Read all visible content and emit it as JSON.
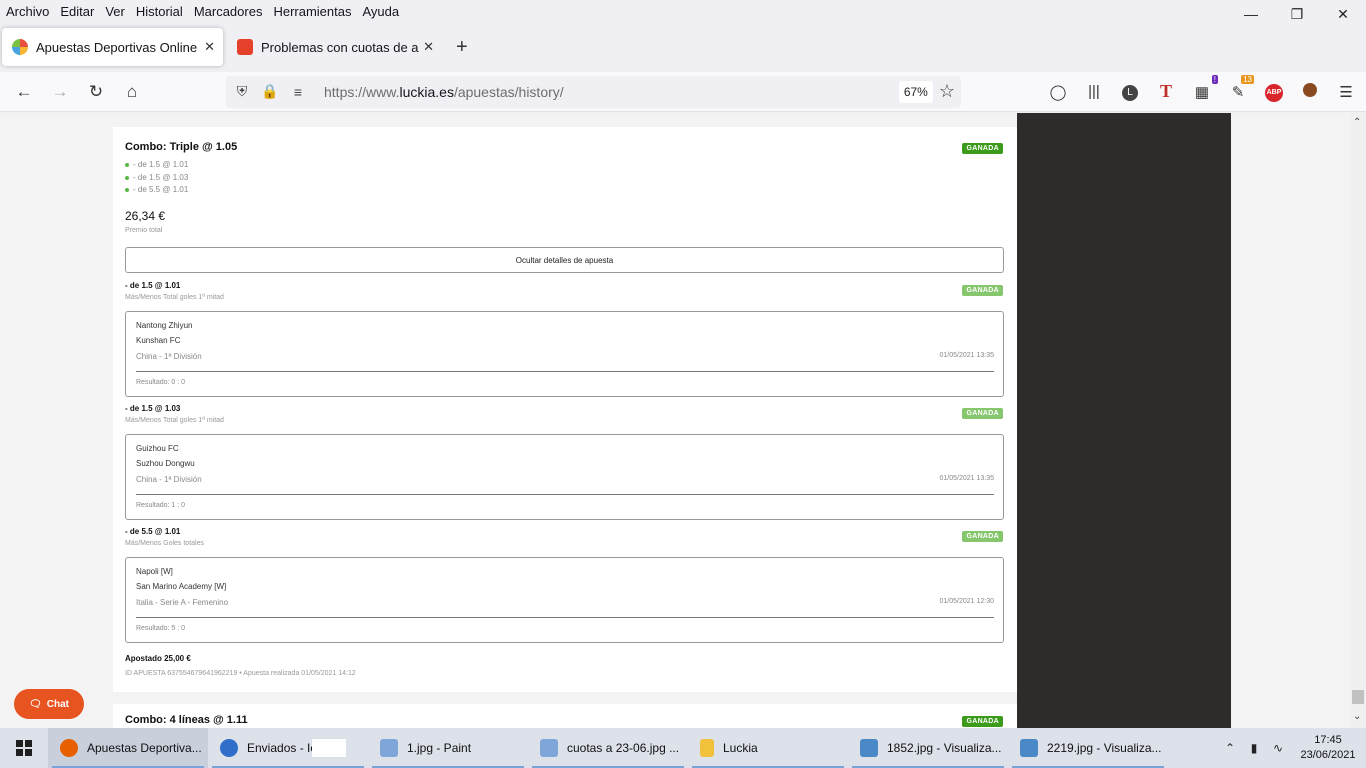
{
  "menubar": {
    "items": [
      "Archivo",
      "Editar",
      "Ver",
      "Historial",
      "Marcadores",
      "Herramientas",
      "Ayuda"
    ]
  },
  "tabs": [
    {
      "label": "Apuestas Deportivas Online | Cu",
      "active": true
    },
    {
      "label": "Problemas con cuotas de apues",
      "active": false
    }
  ],
  "navbar": {
    "url_prefix": "https://www.",
    "url_domain": "luckia.es",
    "url_path": "/apuestas/history/",
    "zoom": "67%",
    "ext_badge_purple": "!",
    "ext_badge_orange": "13",
    "abp": "ABP",
    "profile_letter": "L",
    "t_letter": "T"
  },
  "bet1": {
    "title": "Combo: Triple @ 1.05",
    "status": "GANADA",
    "legs": [
      "- de 1.5 @ 1.01",
      "- de 1.5 @ 1.03",
      "- de 5.5 @ 1.01"
    ],
    "prize": "26,34 €",
    "prize_label": "Premio total",
    "toggle_label": "Ocultar detalles de apuesta",
    "selections": [
      {
        "title": "- de 1.5 @ 1.01",
        "market": "Más/Menos Total goles 1ª mitad",
        "status": "GANADA",
        "home": "Nantong Zhiyun",
        "away": "Kunshan FC",
        "league": "China - 1ª División",
        "date": "01/05/2021 13:35",
        "result": "Resultado: 0 : 0"
      },
      {
        "title": "- de 1.5 @ 1.03",
        "market": "Más/Menos Total goles 1ª mitad",
        "status": "GANADA",
        "home": "Guizhou FC",
        "away": "Suzhou Dongwu",
        "league": "China - 1ª División",
        "date": "01/05/2021 13:35",
        "result": "Resultado: 1 : 0"
      },
      {
        "title": "- de 5.5 @ 1.01",
        "market": "Más/Menos Goles totales",
        "status": "GANADA",
        "home": "Napoli [W]",
        "away": "San Marino Academy [W]",
        "league": "Italia - Serie A - Femenino",
        "date": "01/05/2021 12:30",
        "result": "Resultado: 5 : 0"
      }
    ],
    "stake": "Apostado 25,00 €",
    "bet_id": "ID APUESTA 637554679641962219 • Apuesta realizada 01/05/2021 14:12"
  },
  "bet2": {
    "title": "Combo: 4 líneas @ 1.11",
    "status": "GANADA"
  },
  "chat": {
    "label": "Chat"
  },
  "taskbar": {
    "items": [
      {
        "label": "Apuestas Deportiva...",
        "color": "#e66000",
        "active": true
      },
      {
        "label": "Enviados - Ic",
        "color": "#2f6fc9",
        "active": false
      },
      {
        "label": "1.jpg - Paint",
        "color": "#7fa6d8",
        "active": false
      },
      {
        "label": "cuotas a 23-06.jpg ...",
        "color": "#7fa6d8",
        "active": false
      },
      {
        "label": "Luckia",
        "color": "#f2c13c",
        "active": false
      },
      {
        "label": "1852.jpg - Visualiza...",
        "color": "#4a88c7",
        "active": false
      },
      {
        "label": "2219.jpg - Visualiza...",
        "color": "#4a88c7",
        "active": false
      }
    ],
    "time": "17:45",
    "date": "23/06/2021"
  }
}
